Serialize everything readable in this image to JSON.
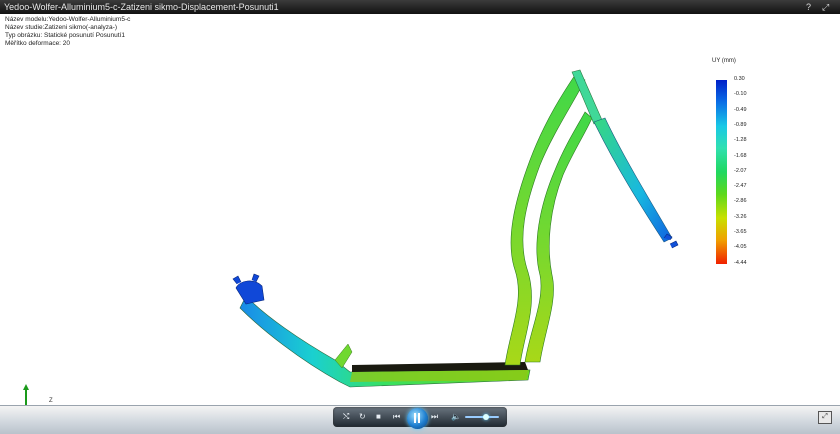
{
  "window": {
    "title": "Yedoo-Wolfer-Alluminium5-c-Zatizeni sikmo-Displacement-Posunuti1",
    "help": "?",
    "close": "⤢"
  },
  "info": {
    "model": "Název modelu:Yedoo-Wolfer-Alluminium5-c",
    "study": "Název studie:Zatizeni sikmo(-analyza-)",
    "plot_type": "Typ obrázku: Statické posunutí Posunutí1",
    "scale": "Měřítko deformace: 20"
  },
  "legend": {
    "unit": "UY (mm)",
    "ticks": [
      "0.30",
      "-0.10",
      "-0.49",
      "-0.89",
      "-1.28",
      "-1.68",
      "-2.07",
      "-2.47",
      "-2.86",
      "-3.26",
      "-3.65",
      "-4.05",
      "-4.44"
    ],
    "colors": [
      "#0020c8",
      "#0a6ee6",
      "#18c8e6",
      "#30e0b0",
      "#20d860",
      "#5cd81c",
      "#c8e000",
      "#f0a000",
      "#f02000"
    ]
  },
  "axes": {
    "z_label": "Z"
  },
  "player": {
    "shuffle": "⤭",
    "repeat": "↻",
    "stop": "■",
    "prev": "⏮",
    "next": "⏭",
    "volume": "🔈",
    "fullscreen": "⤢"
  }
}
